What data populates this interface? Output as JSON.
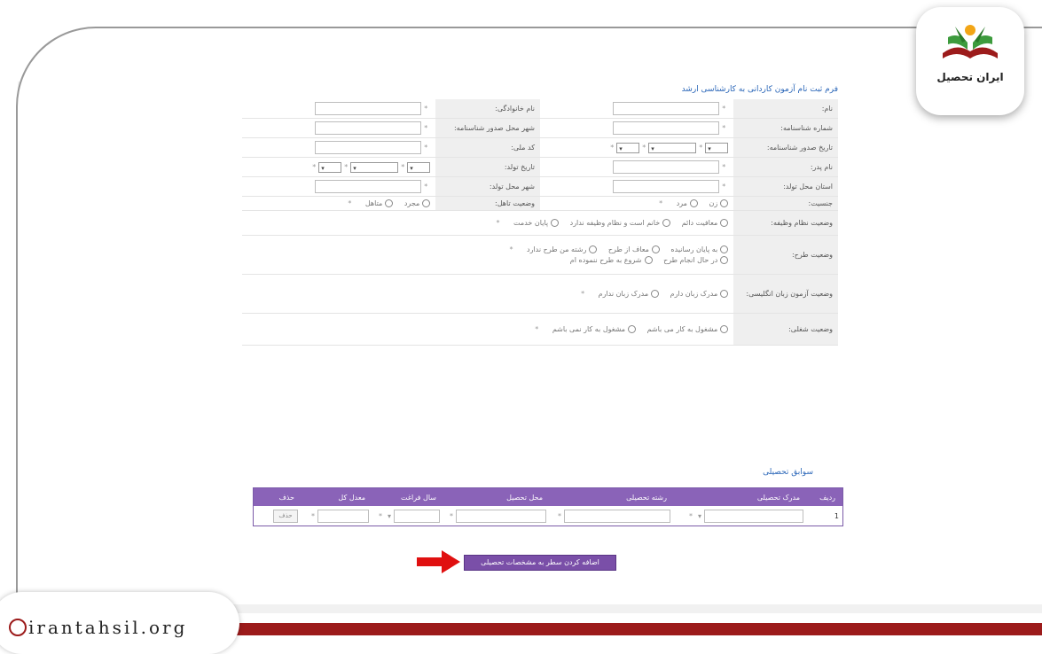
{
  "form_title": "فرم ثبت نام آزمون کاردانی به کارشناسی ارشد",
  "rows": [
    {
      "right_label": "نام:",
      "left_label": "نام خانوادگی:"
    },
    {
      "right_label": "شماره شناسنامه:",
      "left_label": "شهر محل صدور شناسنامه:"
    },
    {
      "right_label": "تاریخ صدور شناسنامه:",
      "left_label": "کد ملی:"
    },
    {
      "right_label": "نام پدر:",
      "left_label": "تاریخ تولد:"
    },
    {
      "right_label": "استان محل تولد:",
      "left_label": "شهر محل تولد:"
    },
    {
      "right_label": "جنسیت:",
      "left_label": "وضعیت تاهل:"
    }
  ],
  "gender_options": [
    "زن",
    "مرد"
  ],
  "marital_options": [
    "مجرد",
    "متاهل"
  ],
  "military": {
    "label": "وضعیت نظام وظیفه:",
    "options": [
      "معافیت دائم",
      "خانم است و نظام وظیفه ندارد",
      "پایان خدمت"
    ]
  },
  "plan": {
    "label": "وضعیت طرح:",
    "options": [
      "به پایان رسانیده",
      "معاف از طرح",
      "رشته من طرح ندارد",
      "در حال انجام طرح",
      "شروع به طرح ننموده ام"
    ]
  },
  "english": {
    "label": "وضعیت آزمون زبان انگلیسی:",
    "options": [
      "مدرک زبان دارم",
      "مدرک زبان ندارم"
    ]
  },
  "job": {
    "label": "وضعیت شغلی:",
    "options": [
      "مشغول به کار می باشم",
      "مشغول به کار نمی باشم"
    ]
  },
  "required_mark": "*",
  "select_arrow": "▾",
  "education_title": "سوابق تحصیلی",
  "grid_headers": [
    "ردیف",
    "مدرک تحصیلی",
    "رشته تحصیلی",
    "محل تحصیل",
    "سال فراغت",
    "معدل کل",
    "حذف"
  ],
  "grid_row": {
    "index": "1",
    "delete_label": "حذف"
  },
  "add_row_button": "اضافه کردن سطر به مشخصات تحصیلی",
  "logo_text": "ایران تحصیل",
  "footer_url": "irantahsil.org",
  "colors": {
    "accent": "#8a63b8",
    "brand_red": "#9c1b1b",
    "link_blue": "#2a66b8"
  }
}
